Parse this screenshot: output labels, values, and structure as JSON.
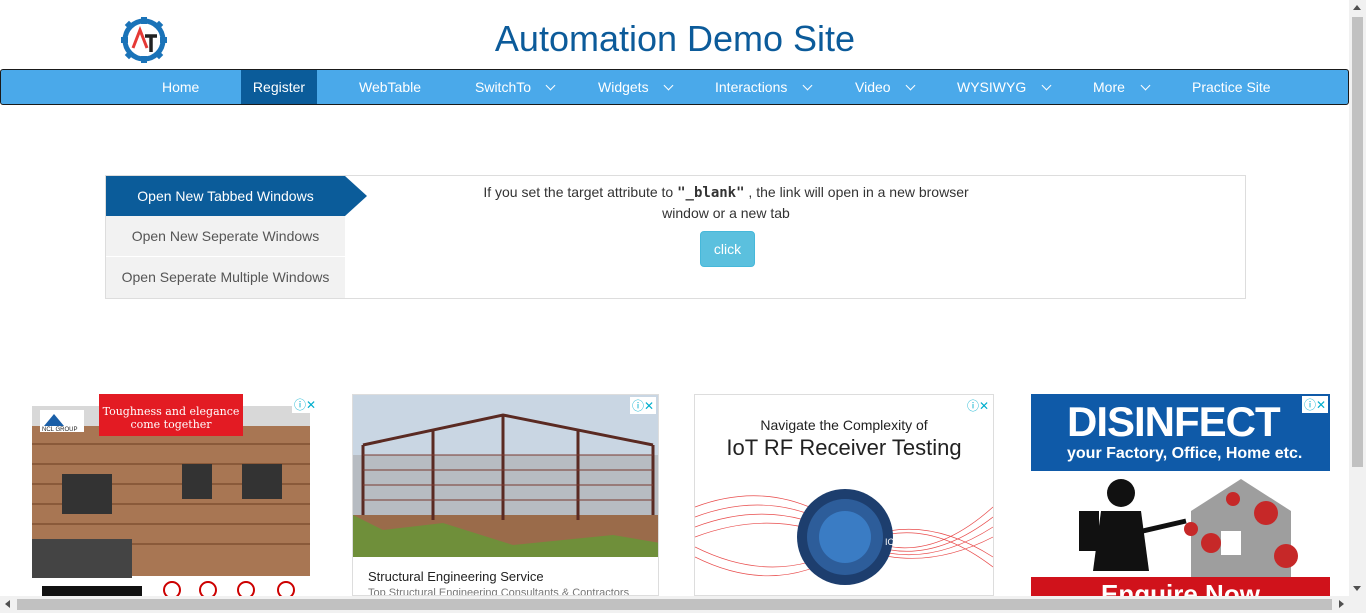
{
  "site": {
    "title": "Automation Demo Site",
    "logo_letters": "AT"
  },
  "nav": {
    "items": [
      {
        "label": "Home",
        "dropdown": false,
        "active": false
      },
      {
        "label": "Register",
        "dropdown": false,
        "active": true
      },
      {
        "label": "WebTable",
        "dropdown": false,
        "active": false
      },
      {
        "label": "SwitchTo",
        "dropdown": true,
        "active": false
      },
      {
        "label": "Widgets",
        "dropdown": true,
        "active": false
      },
      {
        "label": "Interactions",
        "dropdown": true,
        "active": false
      },
      {
        "label": "Video",
        "dropdown": true,
        "active": false
      },
      {
        "label": "WYSIWYG",
        "dropdown": true,
        "active": false
      },
      {
        "label": "More",
        "dropdown": true,
        "active": false
      },
      {
        "label": "Practice Site",
        "dropdown": false,
        "active": false
      }
    ]
  },
  "windows": {
    "tabs": [
      {
        "label": "Open New Tabbed Windows",
        "active": true
      },
      {
        "label": "Open New Seperate Windows",
        "active": false
      },
      {
        "label": "Open Seperate Multiple Windows",
        "active": false
      }
    ],
    "desc_before": "If you set the target attribute to ",
    "desc_code": "\"_blank\"",
    "desc_after": " , the link will open in a new browser window or a new tab",
    "button_label": "click"
  },
  "ads": {
    "ad1": {
      "brand": "NCL GROUP",
      "banner": "Toughness and elegance come together"
    },
    "ad2": {
      "title": "Structural Engineering Service",
      "subtitle": "Top Structural Engineering Consultants & Contractors"
    },
    "ad3": {
      "line1": "Navigate the Complexity of",
      "line2": "IoT RF Receiver Testing",
      "chip_label": "IOT"
    },
    "ad4": {
      "headline": "DISINFECT",
      "sub": "your Factory, Office, Home etc.",
      "cta": "Enquire Now"
    }
  },
  "colors": {
    "brand": "#0b5c9a",
    "nav_bg": "#4aa9ea",
    "button": "#5bc0de"
  }
}
